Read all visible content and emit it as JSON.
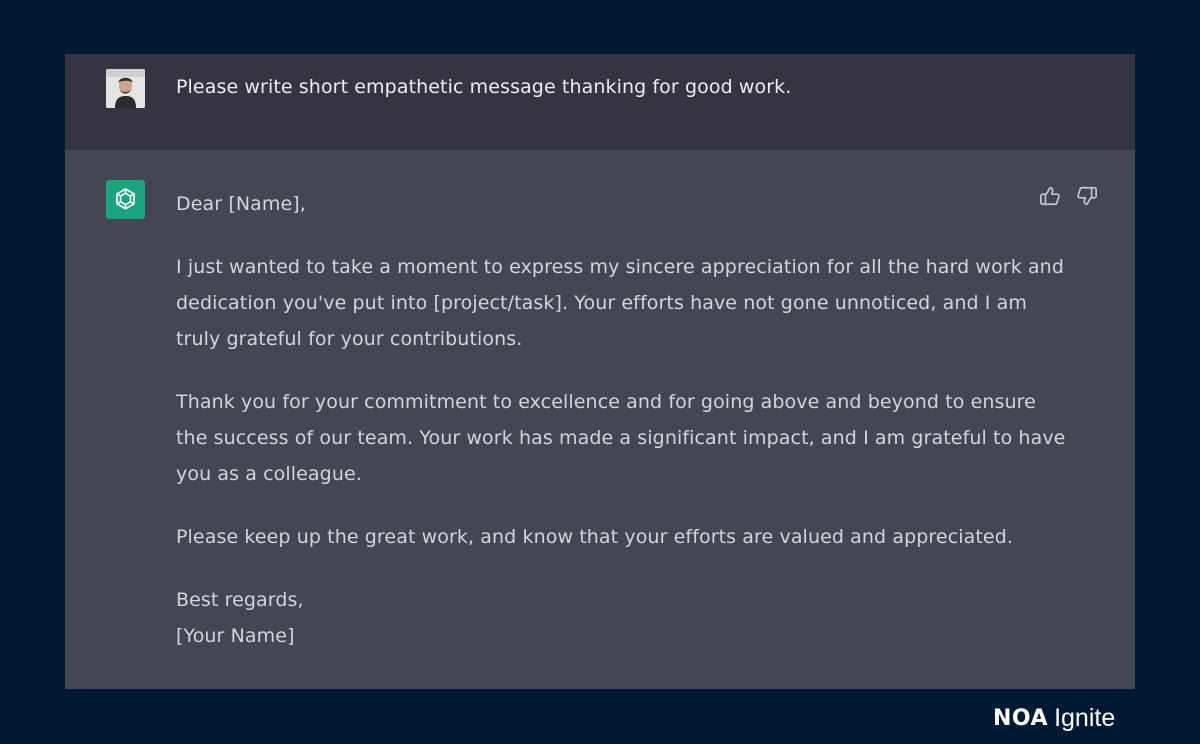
{
  "conversation": {
    "user": {
      "avatar": "user-avatar-photo",
      "message": "Please write short empathetic message thanking for good work."
    },
    "assistant": {
      "avatar": "openai-logo-icon",
      "avatar_color": "#19a67e",
      "paragraphs": [
        "Dear [Name],",
        "I just wanted to take a moment to express my sincere appreciation for all the hard work and",
        "dedication you've put into [project/task]. Your efforts have not gone unnoticed, and I am",
        "truly grateful for your contributions.",
        "Thank you for your commitment to excellence and for going above and beyond to ensure",
        "the success of our team. Your work has made a significant impact, and I am grateful to have",
        "you as a colleague.",
        "Please keep up the great work, and know that your efforts are valued and appreciated.",
        "Best regards,",
        "[Your Name]"
      ],
      "feedback": {
        "thumbs_up_icon": "thumbs-up-icon",
        "thumbs_down_icon": "thumbs-down-icon"
      }
    }
  },
  "brand": {
    "part1": "NOA",
    "part2": "Ignite"
  },
  "colors": {
    "page_background": "#001a33",
    "user_block": "#343541",
    "assistant_block": "#444654",
    "accent": "#19a67e"
  }
}
